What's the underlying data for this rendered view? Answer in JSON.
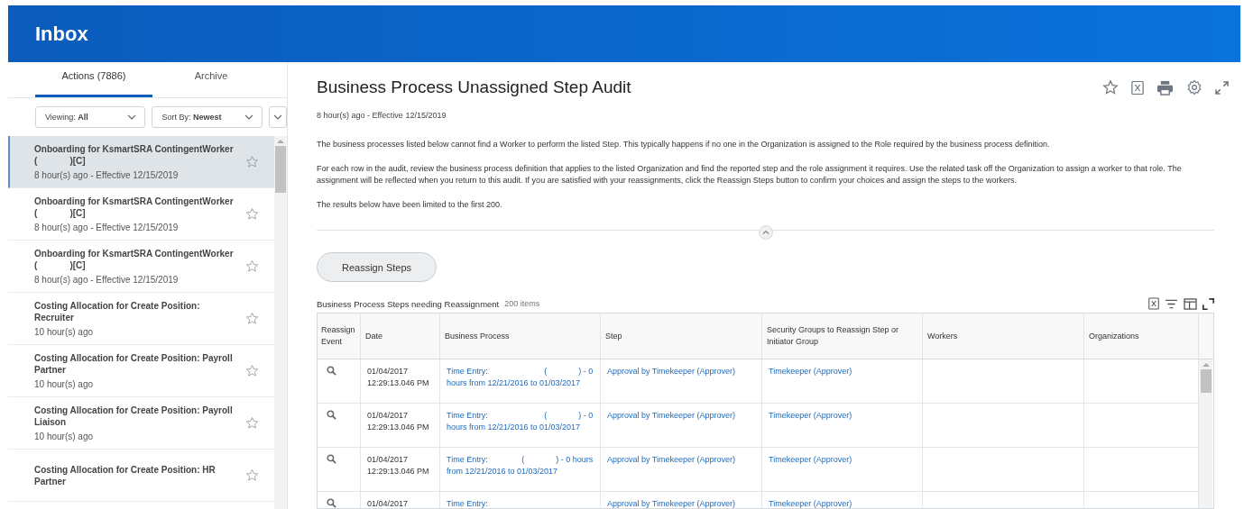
{
  "header": {
    "title": "Inbox"
  },
  "tabs": [
    {
      "label": "Actions (7886)",
      "selected": true
    },
    {
      "label": "Archive",
      "selected": false
    }
  ],
  "filters": [
    {
      "label": "Viewing:",
      "value": "All"
    },
    {
      "label": "Sort By:",
      "value": "Newest"
    }
  ],
  "inbox_items": [
    {
      "title": "Onboarding for KsmartSRA ContingentWorker (             )[C]",
      "subtitle": "8 hour(s) ago - Effective 12/15/2019",
      "selected": true,
      "starred": false
    },
    {
      "title": "Onboarding for KsmartSRA ContingentWorker (             )[C]",
      "subtitle": "8 hour(s) ago - Effective 12/15/2019",
      "selected": false,
      "starred": false
    },
    {
      "title": "Onboarding for KsmartSRA ContingentWorker (             )[C]",
      "subtitle": "8 hour(s) ago - Effective 12/15/2019",
      "selected": false,
      "starred": false
    },
    {
      "title": "Costing Allocation for Create Position: Recruiter",
      "subtitle": "10 hour(s) ago",
      "selected": false,
      "starred": false
    },
    {
      "title": "Costing Allocation for Create Position: Payroll Partner",
      "subtitle": "10 hour(s) ago",
      "selected": false,
      "starred": false
    },
    {
      "title": "Costing Allocation for Create Position: Payroll Liaison",
      "subtitle": "10 hour(s) ago",
      "selected": false,
      "starred": false
    },
    {
      "title": "Costing Allocation for Create Position: HR Partner",
      "selected": false,
      "starred": false
    }
  ],
  "detail": {
    "title": "Business Process Unassigned Step Audit",
    "meta": "8 hour(s) ago -  Effective 12/15/2019",
    "paragraphs": [
      "The business processes listed below cannot find a Worker to perform the listed Step. This typically happens if no one in the Organization is assigned to the Role required by the business process definition.",
      "For each row in the audit, review the business process definition that applies to the listed Organization and find the reported step and the role assignment it requires.  Use the related task off the Organization to assign a worker to that role. The assignment will be reflected when you return to this audit. If you are satisfied with your reassignments, click the Reassign Steps button to confirm your choices and assign the steps to the workers.",
      "The results below have been limited to the first 200."
    ],
    "button": "Reassign Steps"
  },
  "table": {
    "title": "Business Process Steps needing Reassignment",
    "count": "200 items",
    "columns": [
      "Reassign Event",
      "Date",
      "Business Process",
      "Step",
      "Security Groups to Reassign Step or Initiator Group",
      "Workers",
      "Organizations"
    ],
    "rows": [
      {
        "date": "01/04/2017 12:29:13.046 PM",
        "process": "Time Entry:                         (              ) - 0 hours from 12/21/2016 to 01/03/2017",
        "step": "Approval by Timekeeper (Approver)",
        "group": "Timekeeper (Approver)"
      },
      {
        "date": "01/04/2017 12:29:13.046 PM",
        "process": "Time Entry:                         (              ) - 0 hours from 12/21/2016 to 01/03/2017",
        "step": "Approval by Timekeeper (Approver)",
        "group": "Timekeeper (Approver)"
      },
      {
        "date": "01/04/2017 12:29:13.046 PM",
        "process": "Time Entry:               (              ) - 0 hours from 12/21/2016 to 01/03/2017",
        "step": "Approval by Timekeeper (Approver)",
        "group": "Timekeeper (Approver)"
      },
      {
        "date": "01/04/2017",
        "process": "Time Entry:",
        "step": "Approval by Timekeeper (Approver)",
        "group": "Timekeeper (Approver)"
      }
    ]
  }
}
